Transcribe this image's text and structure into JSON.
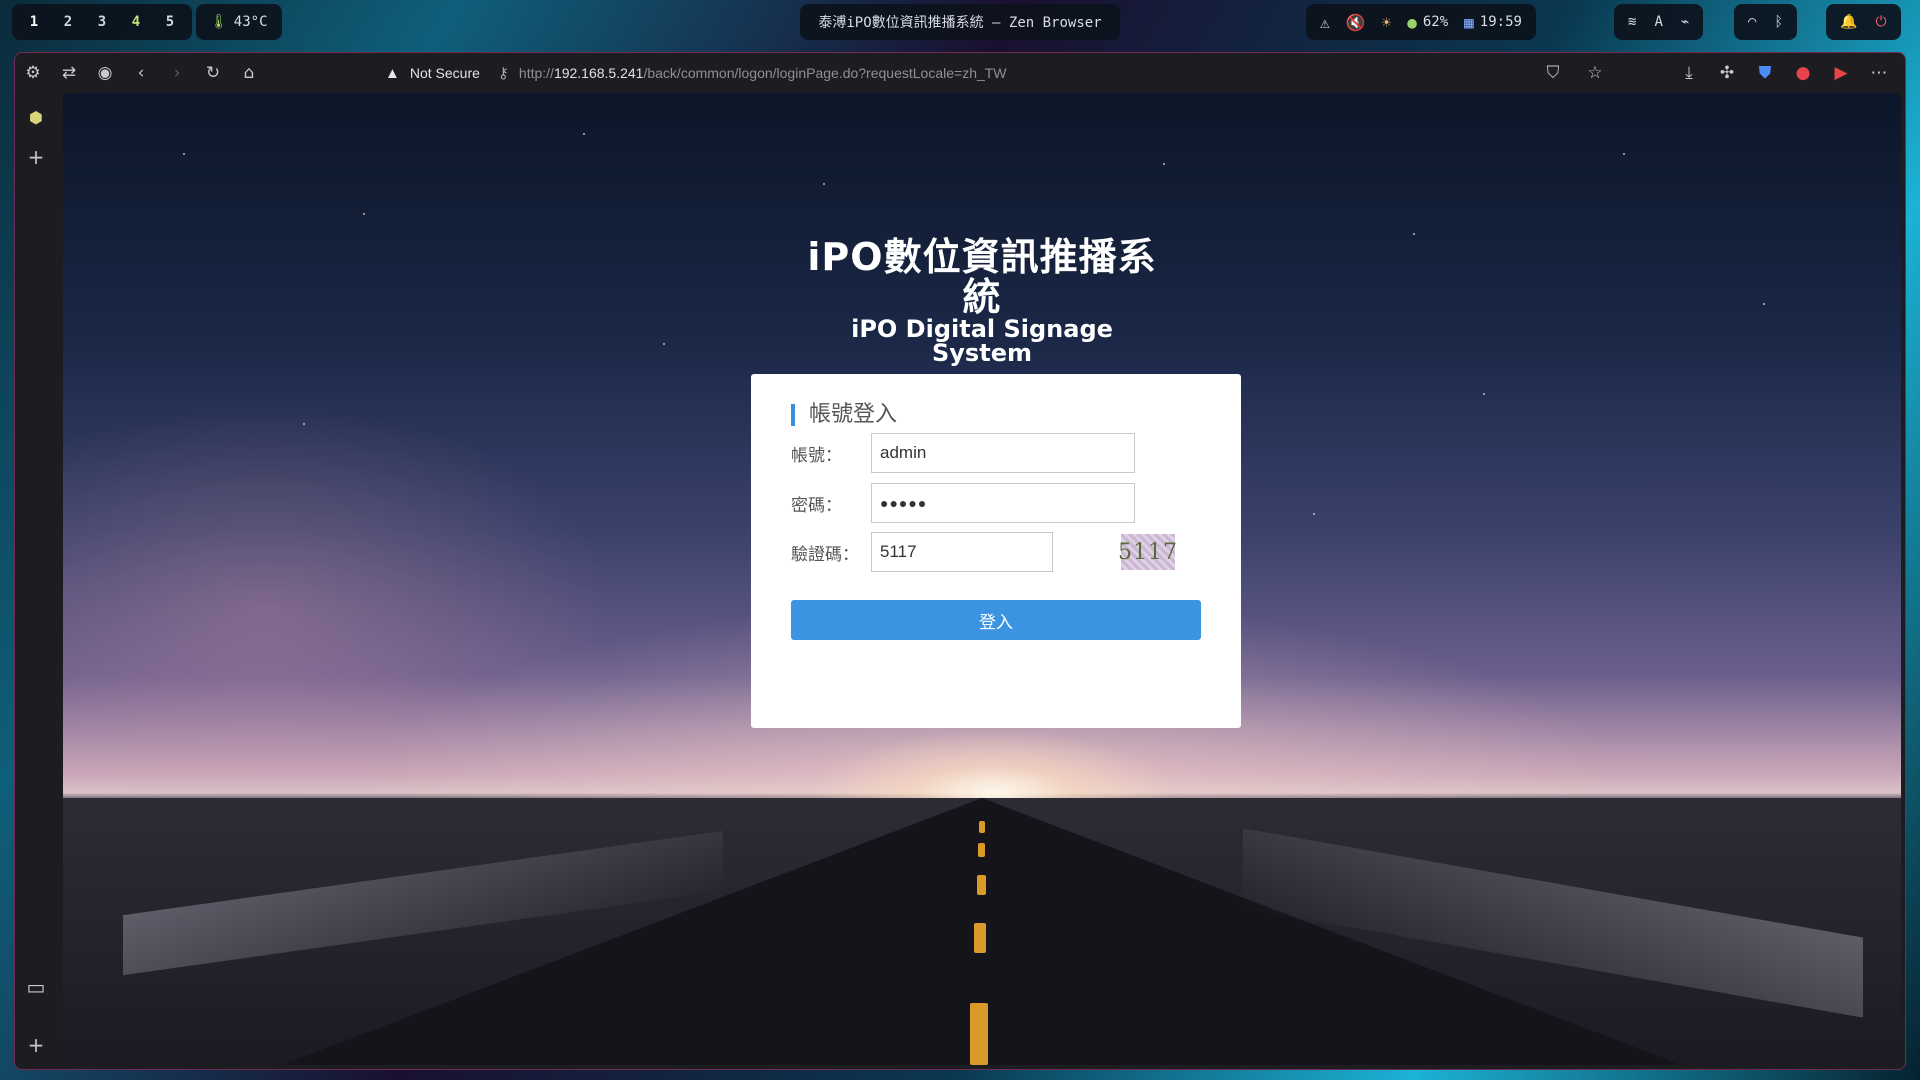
{
  "topbar": {
    "workspaces": [
      "1",
      "2",
      "3",
      "4",
      "5"
    ],
    "temperature": "43°C",
    "window_title": "泰溥iPO數位資訊推播系統 — Zen Browser",
    "battery": "62%",
    "clock": "19:59",
    "keyboard_layout": "A"
  },
  "browser": {
    "security_label": "Not Secure",
    "url_scheme": "http://",
    "url_host": "192.168.5.241",
    "url_path": "/back/common/logon/loginPage.do?requestLocale=zh_TW"
  },
  "page": {
    "logo_zh": "iPO數位資訊推播系統",
    "logo_en": "iPO Digital Signage System",
    "card_title": "帳號登入",
    "account_label": "帳號：",
    "account_value": "admin",
    "password_label": "密碼：",
    "password_value": "●●●●●",
    "captcha_label": "驗證碼：",
    "captcha_value": "5117",
    "captcha_image_text": "5117",
    "login_button": "登入"
  },
  "colors": {
    "accent": "#3a94e2",
    "card_bg": "#ffffff",
    "window_border": "#6d2b56"
  }
}
